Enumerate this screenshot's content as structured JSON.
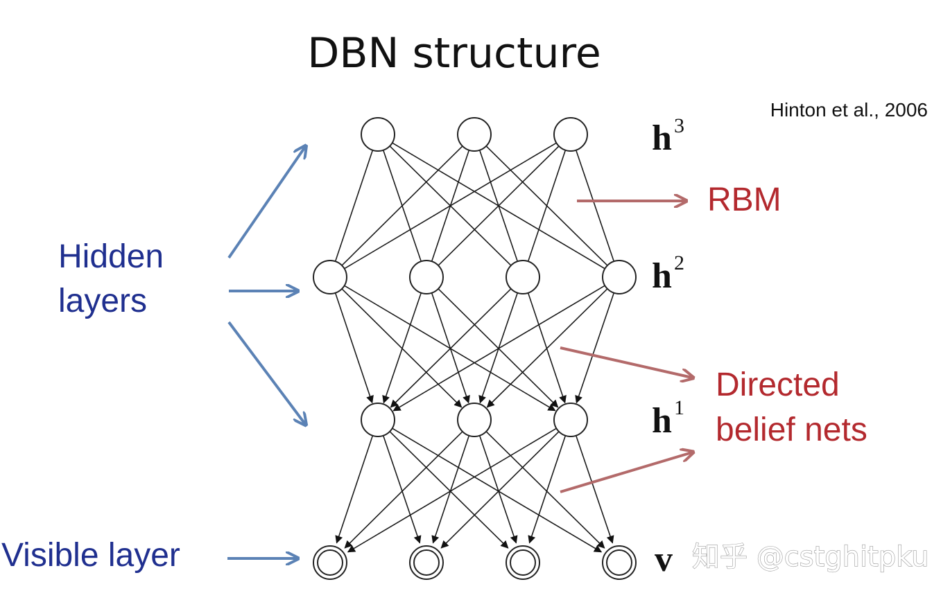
{
  "title": "DBN structure",
  "citation": "Hinton et al., 2006",
  "labels": {
    "hidden_line1": "Hidden",
    "hidden_line2": "layers",
    "visible_layer": "Visible layer",
    "rbm": "RBM",
    "directed_line1": "Directed",
    "directed_line2": "belief nets"
  },
  "layers": [
    {
      "id": "h3",
      "base": "h",
      "sup": "3",
      "nodes": 3
    },
    {
      "id": "h2",
      "base": "h",
      "sup": "2",
      "nodes": 4
    },
    {
      "id": "h1",
      "base": "h",
      "sup": "1",
      "nodes": 3
    },
    {
      "id": "v",
      "base": "v",
      "sup": "",
      "nodes": 4
    }
  ],
  "watermark": "知乎 @cstghitpku",
  "colors": {
    "blue_arrow": "#5b82b5",
    "red_arrow": "#b36a6a",
    "blue_text": "#1f2f8f",
    "red_text": "#b3292e",
    "node_stroke": "#222222"
  }
}
